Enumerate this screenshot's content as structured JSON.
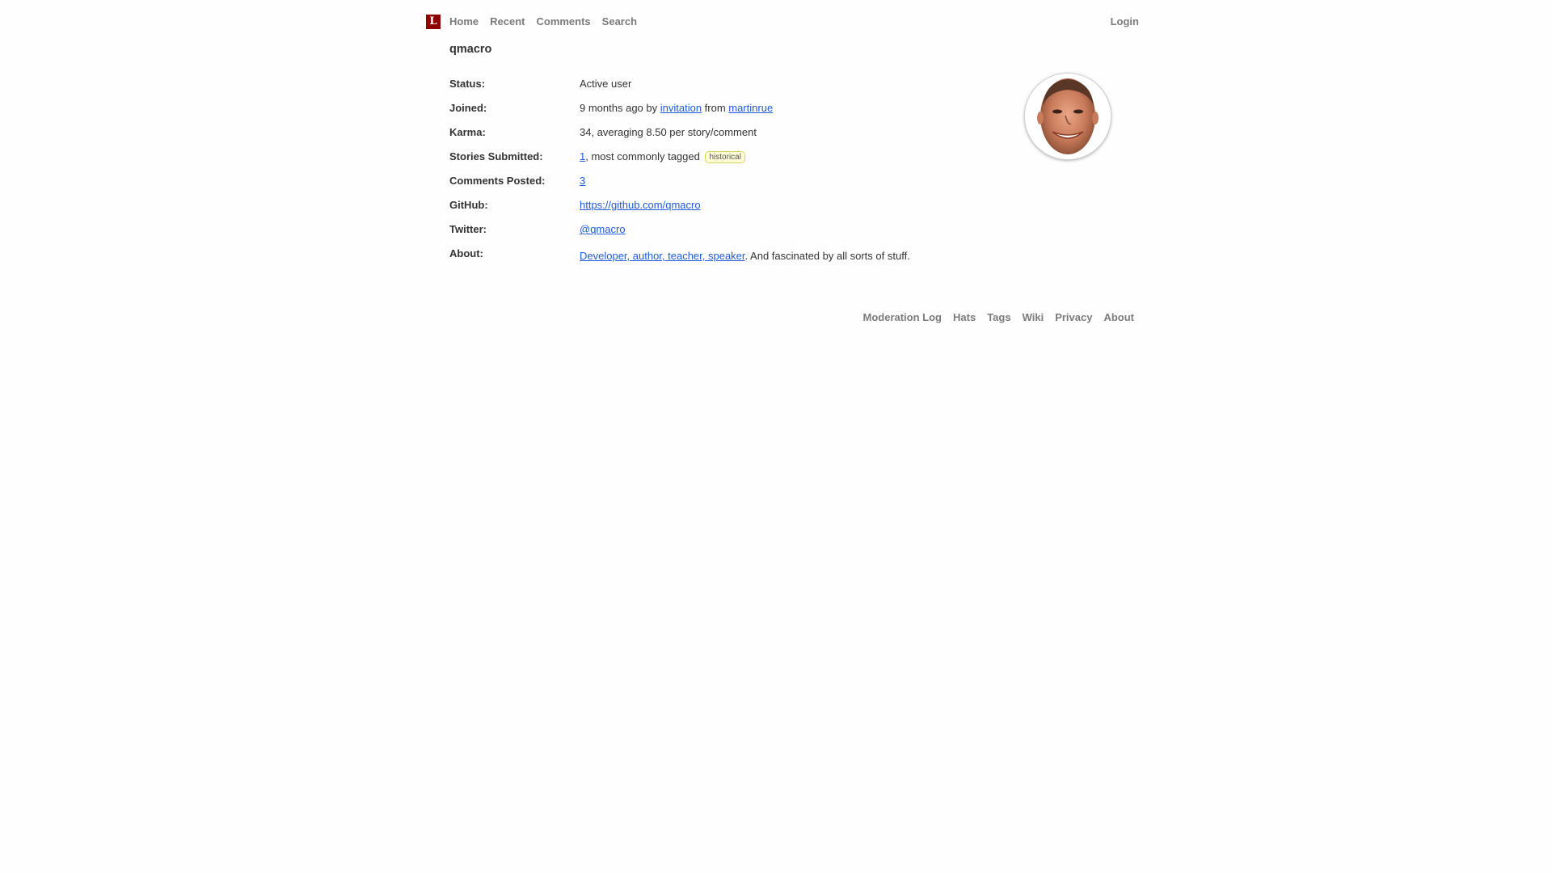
{
  "header": {
    "logo_letter": "L",
    "nav": [
      "Home",
      "Recent",
      "Comments",
      "Search"
    ],
    "login_label": "Login"
  },
  "user": {
    "username": "qmacro"
  },
  "profile": {
    "status": {
      "label": "Status:",
      "value": "Active user"
    },
    "joined": {
      "label": "Joined:",
      "prefix": "9 months ago by ",
      "link_invitation": "invitation",
      "middle": " from ",
      "link_inviter": "martinrue"
    },
    "karma": {
      "label": "Karma:",
      "value": "34, averaging 8.50 per story/comment"
    },
    "stories": {
      "label": "Stories Submitted:",
      "count_link": "1",
      "suffix": ", most commonly tagged",
      "tag": "historical"
    },
    "comments": {
      "label": "Comments Posted:",
      "count_link": "3"
    },
    "github": {
      "label": "GitHub:",
      "link": "https://github.com/qmacro"
    },
    "twitter": {
      "label": "Twitter:",
      "link": "@qmacro"
    },
    "about": {
      "label": "About:",
      "link": "Developer, author, teacher, speaker",
      "suffix": ". And fascinated by all sorts of stuff."
    }
  },
  "footer": {
    "links": [
      "Moderation Log",
      "Hats",
      "Tags",
      "Wiki",
      "Privacy",
      "About"
    ]
  },
  "colors": {
    "logo_bg": "#8e0000",
    "link": "#1f5bdb",
    "nav_text": "#7b7b7b",
    "tag_bg": "#fffcd7",
    "tag_border": "#d5d458"
  },
  "icons": {
    "avatar": "user-avatar-photo"
  }
}
